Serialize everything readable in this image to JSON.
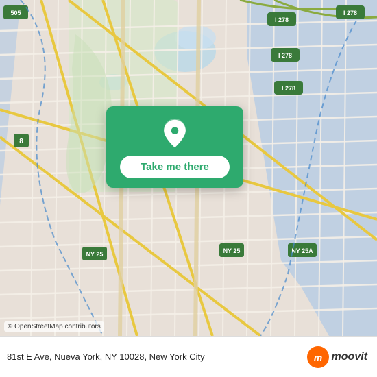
{
  "map": {
    "attribution": "© OpenStreetMap contributors"
  },
  "card": {
    "button_label": "Take me there"
  },
  "bottom_bar": {
    "address": "81st E Ave, Nueva York, NY 10028, New York City"
  },
  "icons": {
    "pin": "location-pin-icon",
    "moovit": "moovit-logo-icon"
  }
}
